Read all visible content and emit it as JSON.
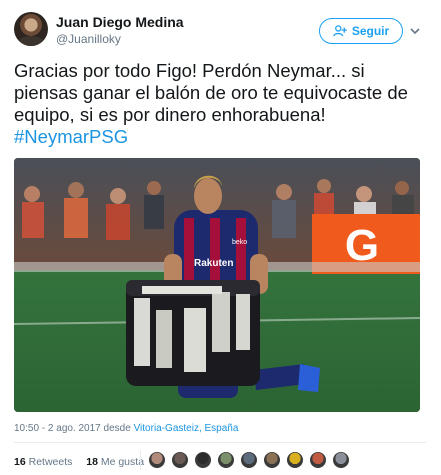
{
  "user": {
    "name": "Juan Diego Medina",
    "handle": "@Juanilloky"
  },
  "follow_button": {
    "label": "Seguir"
  },
  "tweet": {
    "text": "Gracias por todo Figo! Perdón Neymar... si piensas ganar el balón de oro te equivocaste de equipo, si es por dinero enhorabuena!",
    "hashtag": "#NeymarPSG"
  },
  "photo": {
    "jersey_text": "Rakuten",
    "jersey_brand": "beko",
    "sign_letter": "G"
  },
  "meta": {
    "time": "10:50 - 2 ago. 2017",
    "from_word": "desde",
    "location": "Vitoria-Gasteiz, España"
  },
  "stats": {
    "retweets_count": "16",
    "retweets_label": "Retweets",
    "likes_count": "18",
    "likes_label": "Me gusta"
  },
  "likers": [
    {
      "name": "liker-1",
      "color": "#b08a7a"
    },
    {
      "name": "liker-2",
      "color": "#6a5a55"
    },
    {
      "name": "liker-3",
      "color": "#2b2b2b"
    },
    {
      "name": "liker-4",
      "color": "#7a8f6a"
    },
    {
      "name": "liker-5",
      "color": "#5d6c7d"
    },
    {
      "name": "liker-6",
      "color": "#8a7055"
    },
    {
      "name": "liker-7",
      "color": "#d8b020"
    },
    {
      "name": "liker-8",
      "color": "#c05a40"
    },
    {
      "name": "liker-9",
      "color": "#8a8f9a"
    }
  ]
}
